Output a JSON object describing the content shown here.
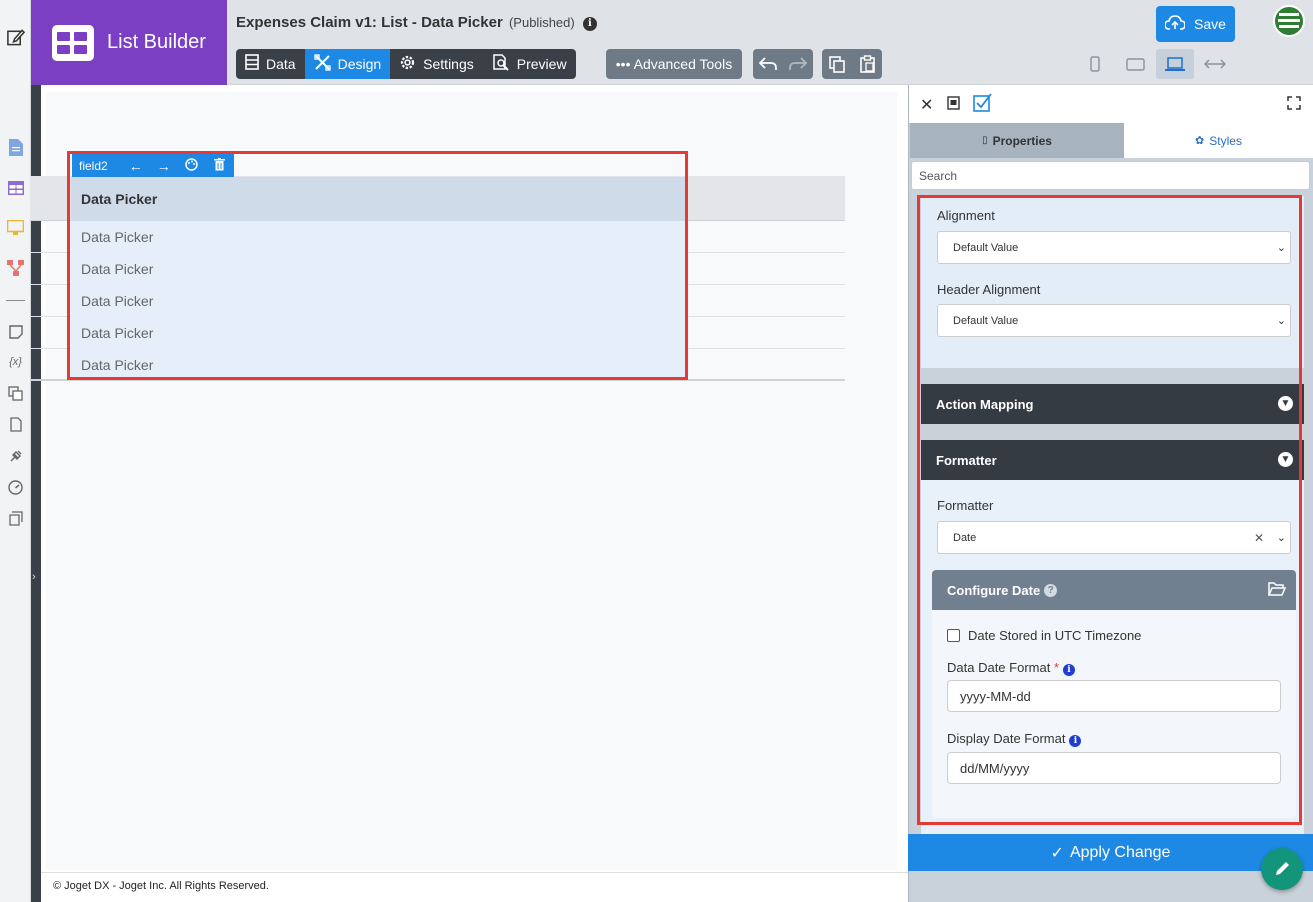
{
  "brand": {
    "title": "List Builder"
  },
  "header": {
    "app_title": "Expenses Claim v1: List - Data Picker",
    "status": "(Published)",
    "info_glyph": "i",
    "save_label": "Save",
    "tabs": [
      {
        "label": "Data",
        "icon": "list-icon"
      },
      {
        "label": "Design",
        "icon": "design-tools-icon",
        "active": true
      },
      {
        "label": "Settings",
        "icon": "gear-icon"
      },
      {
        "label": "Preview",
        "icon": "preview-icon"
      }
    ],
    "advanced_tools": "••• Advanced Tools",
    "accent": "#1e88e5"
  },
  "canvas": {
    "column_toolbar": {
      "label": "field2"
    },
    "column_header": "Data Picker",
    "rows": [
      "Data Picker",
      "Data Picker",
      "Data Picker",
      "Data Picker",
      "Data Picker"
    ],
    "footer": "© Joget DX - Joget Inc. All Rights Reserved."
  },
  "panel": {
    "tabs": {
      "properties": "Properties",
      "styles": "Styles"
    },
    "search_placeholder": "Search",
    "alignment": {
      "label": "Alignment",
      "value": "Default Value"
    },
    "header_alignment": {
      "label": "Header Alignment",
      "value": "Default Value"
    },
    "sections": {
      "action_mapping": "Action Mapping",
      "formatter": "Formatter"
    },
    "formatter": {
      "label": "Formatter",
      "value": "Date"
    },
    "configure_date": {
      "title": "Configure Date",
      "utc_label": "Date Stored in UTC Timezone",
      "utc_checked": false,
      "data_format_label": "Data Date Format",
      "data_format_value": "yyyy-MM-dd",
      "display_format_label": "Display Date Format",
      "display_format_value": "dd/MM/yyyy"
    },
    "apply_label": "Apply Change"
  },
  "colors": {
    "brand": "#7b3fc4",
    "accent": "#1e88e5",
    "highlight": "#e53935",
    "dark": "#353b42"
  }
}
